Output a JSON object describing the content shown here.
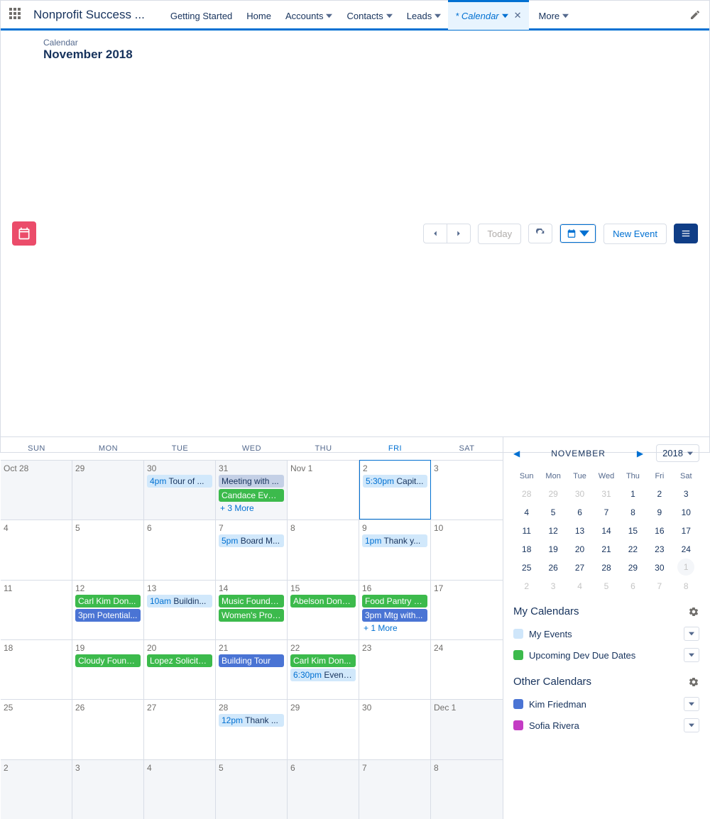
{
  "app_title": "Nonprofit Success ...",
  "nav": {
    "tabs": [
      {
        "label": "Getting Started",
        "dropdown": false
      },
      {
        "label": "Home",
        "dropdown": false
      },
      {
        "label": "Accounts",
        "dropdown": true
      },
      {
        "label": "Contacts",
        "dropdown": true
      },
      {
        "label": "Leads",
        "dropdown": true
      },
      {
        "label": "* Calendar",
        "dropdown": true,
        "active": true,
        "closable": true
      },
      {
        "label": "More",
        "dropdown": true
      }
    ]
  },
  "header": {
    "sub": "Calendar",
    "title": "November 2018",
    "today": "Today",
    "new_event": "New Event"
  },
  "dow": [
    "SUN",
    "MON",
    "TUE",
    "WED",
    "THU",
    "FRI",
    "SAT"
  ],
  "active_dow_index": 5,
  "cells": [
    {
      "label": "Oct 28",
      "adjacent": true
    },
    {
      "label": "29",
      "adjacent": true
    },
    {
      "label": "30",
      "adjacent": true,
      "events": [
        {
          "cls": "lightblue",
          "time": "4pm",
          "text": "Tour of ..."
        }
      ]
    },
    {
      "label": "31",
      "adjacent": true,
      "events": [
        {
          "cls": "gray",
          "text": "Meeting with ..."
        },
        {
          "cls": "green",
          "text": "Candace Evan..."
        }
      ],
      "more": "+ 3 More"
    },
    {
      "label": "Nov 1"
    },
    {
      "label": "2",
      "selected": true,
      "events": [
        {
          "cls": "lightblue",
          "time": "5:30pm",
          "text": "Capit..."
        }
      ]
    },
    {
      "label": "3"
    },
    {
      "label": "4"
    },
    {
      "label": "5"
    },
    {
      "label": "6"
    },
    {
      "label": "7",
      "events": [
        {
          "cls": "lightblue",
          "time": "5pm",
          "text": "Board M..."
        }
      ]
    },
    {
      "label": "8"
    },
    {
      "label": "9",
      "events": [
        {
          "cls": "lightblue",
          "time": "1pm",
          "text": "Thank y..."
        }
      ]
    },
    {
      "label": "10"
    },
    {
      "label": "11"
    },
    {
      "label": "12",
      "events": [
        {
          "cls": "green",
          "text": "Carl Kim Don..."
        },
        {
          "cls": "blue",
          "time": "3pm",
          "text": "Potential..."
        }
      ]
    },
    {
      "label": "13",
      "events": [
        {
          "cls": "lightblue",
          "time": "10am",
          "text": "Buildin..."
        }
      ]
    },
    {
      "label": "14",
      "events": [
        {
          "cls": "green",
          "text": "Music Founda..."
        },
        {
          "cls": "green",
          "text": "Women's Prog..."
        }
      ]
    },
    {
      "label": "15",
      "events": [
        {
          "cls": "green",
          "text": "Abelson Dona..."
        }
      ]
    },
    {
      "label": "16",
      "events": [
        {
          "cls": "green",
          "text": "Food Pantry S..."
        },
        {
          "cls": "blue",
          "time": "3pm",
          "text": "Mtg with..."
        }
      ],
      "more": "+ 1 More"
    },
    {
      "label": "17"
    },
    {
      "label": "18"
    },
    {
      "label": "19",
      "events": [
        {
          "cls": "green",
          "text": "Cloudy Found..."
        }
      ]
    },
    {
      "label": "20",
      "events": [
        {
          "cls": "green",
          "text": "Lopez Solicita..."
        }
      ]
    },
    {
      "label": "21",
      "events": [
        {
          "cls": "blue",
          "text": "Building Tour"
        }
      ]
    },
    {
      "label": "22",
      "events": [
        {
          "cls": "green",
          "text": "Carl Kim Don..."
        },
        {
          "cls": "lightblue",
          "time": "6:30pm",
          "text": "Event..."
        }
      ]
    },
    {
      "label": "23"
    },
    {
      "label": "24"
    },
    {
      "label": "25"
    },
    {
      "label": "26"
    },
    {
      "label": "27"
    },
    {
      "label": "28",
      "events": [
        {
          "cls": "lightblue",
          "time": "12pm",
          "text": "Thank ..."
        }
      ]
    },
    {
      "label": "29"
    },
    {
      "label": "30"
    },
    {
      "label": "Dec 1",
      "adjacent": true
    },
    {
      "label": "2",
      "adjacent": true
    },
    {
      "label": "3",
      "adjacent": true
    },
    {
      "label": "4",
      "adjacent": true
    },
    {
      "label": "5",
      "adjacent": true
    },
    {
      "label": "6",
      "adjacent": true
    },
    {
      "label": "7",
      "adjacent": true
    },
    {
      "label": "8",
      "adjacent": true
    }
  ],
  "mini": {
    "month": "NOVEMBER",
    "year": "2018",
    "dow": [
      "Sun",
      "Mon",
      "Tue",
      "Wed",
      "Thu",
      "Fri",
      "Sat"
    ],
    "rows": [
      [
        {
          "d": "28",
          "dim": true
        },
        {
          "d": "29",
          "dim": true
        },
        {
          "d": "30",
          "dim": true
        },
        {
          "d": "31",
          "dim": true
        },
        {
          "d": "1"
        },
        {
          "d": "2"
        },
        {
          "d": "3"
        }
      ],
      [
        {
          "d": "4"
        },
        {
          "d": "5"
        },
        {
          "d": "6"
        },
        {
          "d": "7"
        },
        {
          "d": "8"
        },
        {
          "d": "9"
        },
        {
          "d": "10"
        }
      ],
      [
        {
          "d": "11"
        },
        {
          "d": "12"
        },
        {
          "d": "13"
        },
        {
          "d": "14"
        },
        {
          "d": "15"
        },
        {
          "d": "16"
        },
        {
          "d": "17"
        }
      ],
      [
        {
          "d": "18"
        },
        {
          "d": "19"
        },
        {
          "d": "20"
        },
        {
          "d": "21"
        },
        {
          "d": "22"
        },
        {
          "d": "23"
        },
        {
          "d": "24"
        }
      ],
      [
        {
          "d": "25"
        },
        {
          "d": "26"
        },
        {
          "d": "27"
        },
        {
          "d": "28"
        },
        {
          "d": "29"
        },
        {
          "d": "30"
        },
        {
          "d": "1",
          "dim": true,
          "selected": true
        }
      ],
      [
        {
          "d": "2",
          "dim": true
        },
        {
          "d": "3",
          "dim": true
        },
        {
          "d": "4",
          "dim": true
        },
        {
          "d": "5",
          "dim": true
        },
        {
          "d": "6",
          "dim": true
        },
        {
          "d": "7",
          "dim": true
        },
        {
          "d": "8",
          "dim": true
        }
      ]
    ]
  },
  "my_calendars": {
    "title": "My Calendars",
    "items": [
      {
        "label": "My Events",
        "color": "#cfe6fa"
      },
      {
        "label": "Upcoming Dev Due Dates",
        "color": "#3cba4c"
      }
    ]
  },
  "other_calendars": {
    "title": "Other Calendars",
    "items": [
      {
        "label": "Kim Friedman",
        "color": "#4a74d4"
      },
      {
        "label": "Sofia Rivera",
        "color": "#c43cc4"
      }
    ]
  }
}
